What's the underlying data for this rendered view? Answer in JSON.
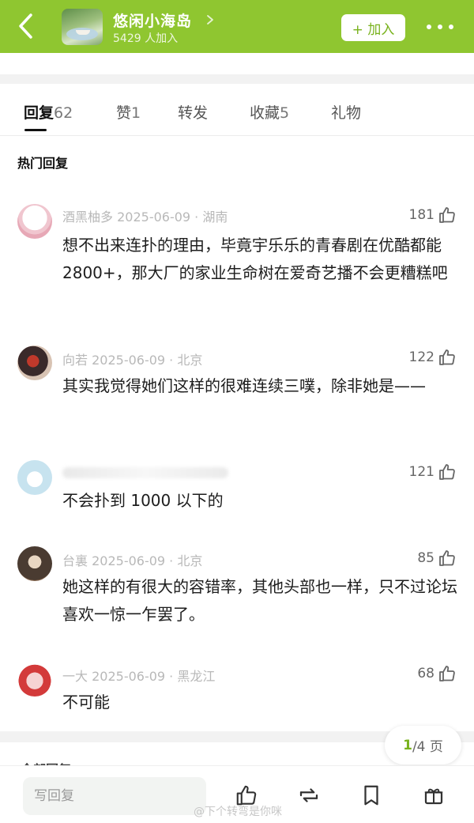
{
  "header": {
    "group_name": "悠闲小海岛",
    "member_count": "5429 人加入",
    "join_label": "+ 加入",
    "accent_color": "#8fc630"
  },
  "tabs": [
    {
      "label": "回复",
      "count": "62",
      "active": true
    },
    {
      "label": "赞",
      "count": "1",
      "active": false
    },
    {
      "label": "转发",
      "count": "",
      "active": false
    },
    {
      "label": "收藏",
      "count": "5",
      "active": false
    },
    {
      "label": "礼物",
      "count": "",
      "active": false
    }
  ],
  "section_title": "热门回复",
  "comments": [
    {
      "author": "酒黑柚多",
      "meta": "2025-06-09 · 湖南",
      "likes": "181",
      "text": "想不出来连扑的理由，毕竟宇乐乐的青春剧在优酷都能 2800+，那大厂的家业生命树在爱奇艺播不会更糟糕吧"
    },
    {
      "author": "向若",
      "meta": "2025-06-09 · 北京",
      "likes": "122",
      "text": "其实我觉得她们这样的很难连续三噗，除非她是——"
    },
    {
      "author": "",
      "meta": "",
      "likes": "121",
      "text": "不会扑到 1000 以下的"
    },
    {
      "author": "台裏",
      "meta": "2025-06-09 · 北京",
      "likes": "85",
      "text": "她这样的有很大的容错率，其他头部也一样，只不过论坛喜欢一惊一乍罢了。"
    },
    {
      "author": "一大",
      "meta": "2025-06-09 · 黑龙江",
      "likes": "68",
      "text": "不可能"
    }
  ],
  "pagination": {
    "current": "1",
    "total": "/4 页"
  },
  "under_section": "全部回复",
  "bottom_bar": {
    "reply_placeholder": "写回复"
  },
  "watermark": "@下个转弯是你咪"
}
